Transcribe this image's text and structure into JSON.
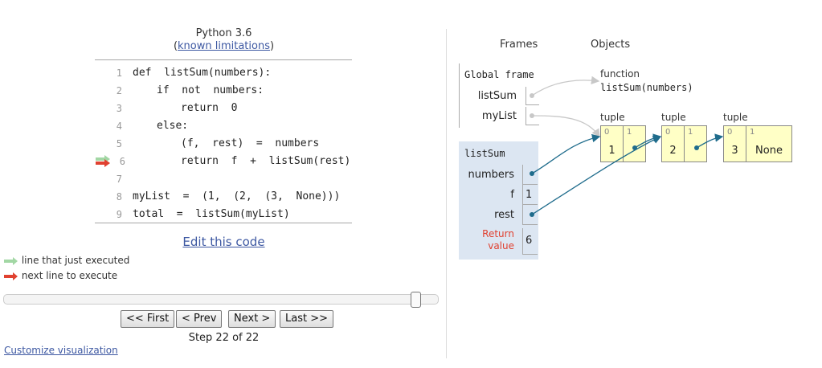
{
  "header": {
    "language": "Python 3.6",
    "limitations_link": "known limitations"
  },
  "code": [
    {
      "num": "1",
      "text": "def  listSum(numbers):",
      "indent": 0
    },
    {
      "num": "2",
      "text": "if  not  numbers:",
      "indent": 1
    },
    {
      "num": "3",
      "text": "return  0",
      "indent": 2
    },
    {
      "num": "4",
      "text": "else:",
      "indent": 1
    },
    {
      "num": "5",
      "text": "(f,  rest)  =  numbers",
      "indent": 2
    },
    {
      "num": "6",
      "text": "return  f  +  listSum(rest)",
      "indent": 2
    },
    {
      "num": "7",
      "text": "",
      "indent": 0
    },
    {
      "num": "8",
      "text": "myList  =  (1,  (2,  (3,  None)))",
      "indent": 0
    },
    {
      "num": "9",
      "text": "total  =  listSum(myList)",
      "indent": 0
    }
  ],
  "current_line": "6",
  "edit_link": "Edit this code",
  "legend": {
    "just_executed": "line that just executed",
    "next_line": "next line to execute",
    "just_executed_color": "#a2d7a4",
    "next_line_color": "#e04130"
  },
  "slider": {
    "step": 22,
    "total": 22
  },
  "buttons": {
    "first": "<< First",
    "prev": "< Prev",
    "next": "Next >",
    "last": "Last >>"
  },
  "step_text": "Step 22 of 22",
  "customize_link": "Customize visualization",
  "viz": {
    "frames_header": "Frames",
    "objects_header": "Objects",
    "global_frame": {
      "title": "Global frame",
      "vars": [
        {
          "name": "listSum"
        },
        {
          "name": "myList"
        }
      ]
    },
    "call_frame": {
      "title": "listSum",
      "vars": [
        {
          "name": "numbers",
          "value": ""
        },
        {
          "name": "f",
          "value": "1"
        },
        {
          "name": "rest",
          "value": ""
        }
      ],
      "return_label": "Return\nvalue",
      "return_value": "6",
      "return_color": "#e04130",
      "bg_color": "#dce6f2"
    },
    "function_obj": {
      "type": "function",
      "signature": "listSum(numbers)"
    },
    "tuples": [
      {
        "label": "tuple",
        "cells": [
          {
            "idx": "0",
            "val": "1"
          },
          {
            "idx": "1",
            "val": ""
          }
        ]
      },
      {
        "label": "tuple",
        "cells": [
          {
            "idx": "0",
            "val": "2"
          },
          {
            "idx": "1",
            "val": ""
          }
        ]
      },
      {
        "label": "tuple",
        "cells": [
          {
            "idx": "0",
            "val": "3"
          },
          {
            "idx": "1",
            "val": "None"
          }
        ]
      }
    ],
    "tuple_color": "#ffffc6",
    "pointer_color": "#1f6c8c"
  }
}
